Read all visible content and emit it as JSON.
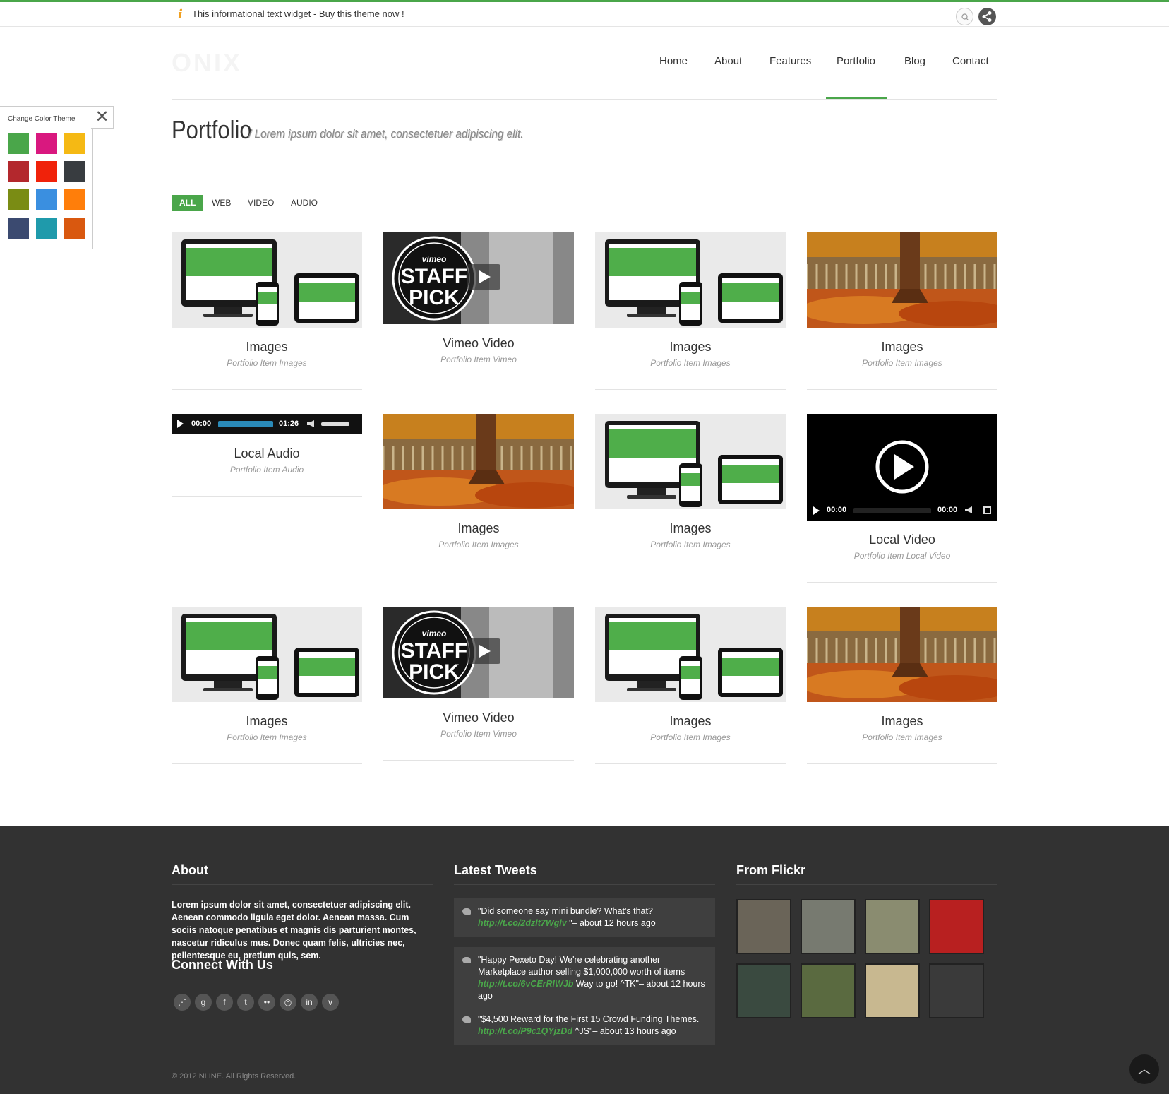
{
  "topbar": {
    "info_text": "This informational text widget - Buy this theme now !"
  },
  "logo": "ONIX",
  "nav": {
    "items": [
      "Home",
      "About",
      "Features",
      "Portfolio",
      "Blog",
      "Contact"
    ],
    "active": "Portfolio"
  },
  "page": {
    "title": "Portfolio",
    "subtitle": "/ Lorem ipsum dolor sit amet, consectetuer adipiscing elit."
  },
  "filters": [
    "ALL",
    "WEB",
    "VIDEO",
    "AUDIO"
  ],
  "color_panel": {
    "label": "Change Color Theme",
    "close": "✕",
    "swatches": [
      "#4aa64a",
      "#d9187f",
      "#f5b914",
      "#b3282d",
      "#f0220a",
      "#383c40",
      "#7a8c14",
      "#3a8fe0",
      "#ff7e0a",
      "#3b4a70",
      "#1f9aab",
      "#d9580f"
    ]
  },
  "portfolio": {
    "items": [
      {
        "title": "Images",
        "subtitle": "Portfolio Item Images",
        "thumb": "devices"
      },
      {
        "title": "Vimeo Video",
        "subtitle": "Portfolio Item Vimeo",
        "thumb": "vimeo"
      },
      {
        "title": "Images",
        "subtitle": "Portfolio Item Images",
        "thumb": "devices"
      },
      {
        "title": "Images",
        "subtitle": "Portfolio Item Images",
        "thumb": "autumn"
      },
      {
        "title": "Local Audio",
        "subtitle": "Portfolio Item Audio",
        "thumb": "audio"
      },
      {
        "title": "Images",
        "subtitle": "Portfolio Item Images",
        "thumb": "autumn"
      },
      {
        "title": "Images",
        "subtitle": "Portfolio Item Images",
        "thumb": "devices"
      },
      {
        "title": "Local Video",
        "subtitle": "Portfolio Item Local Video",
        "thumb": "video"
      },
      {
        "title": "Images",
        "subtitle": "Portfolio Item Images",
        "thumb": "devices"
      },
      {
        "title": "Vimeo Video",
        "subtitle": "Portfolio Item Vimeo",
        "thumb": "vimeo"
      },
      {
        "title": "Images",
        "subtitle": "Portfolio Item Images",
        "thumb": "devices"
      },
      {
        "title": "Images",
        "subtitle": "Portfolio Item Images",
        "thumb": "autumn"
      }
    ],
    "audio": {
      "current": "00:00",
      "duration": "01:26"
    },
    "video": {
      "current": "00:00",
      "duration": "00:00"
    },
    "vimeo_badge": {
      "brand": "vimeo",
      "line1": "STAFF",
      "line2": "PICK"
    }
  },
  "footer": {
    "about_heading": "About",
    "about_text": "Lorem ipsum dolor sit amet, consectetuer adipiscing elit. Aenean commodo ligula eget dolor. Aenean massa. Cum sociis natoque penatibus et magnis dis parturient montes, nascetur ridiculus mus. Donec quam felis, ultricies nec, pellentesque eu, pretium quis, sem.",
    "connect_heading": "Connect With Us",
    "social_icons": [
      "share-icon",
      "google-icon",
      "facebook-icon",
      "twitter-icon",
      "flickr-icon",
      "dribbble-icon",
      "linkedin-icon",
      "vimeo-icon"
    ],
    "social_glyphs": [
      "⋰",
      "g",
      "f",
      "t",
      "••",
      "◎",
      "in",
      "v"
    ],
    "tweets_heading": "Latest Tweets",
    "tweets": [
      {
        "text": "\"Did someone say mini bundle? What's that?",
        "link": "http://t.co/2dzlt7Wglv",
        "after": "\"– about 12 hours ago"
      },
      {
        "text": "\"Happy Pexeto Day! We're celebrating another Marketplace author selling $1,000,000 worth of items",
        "link": "http://t.co/6vCErRlWJb",
        "after": "Way to go! ^TK\"– about 12 hours ago"
      },
      {
        "text": "\"$4,500 Reward for the First 15 Crowd Funding Themes.",
        "link": "http://t.co/P9c1QYjzDd",
        "after": "^JS\"– about 13 hours ago"
      }
    ],
    "flickr_heading": "From Flickr",
    "flickr_colors": [
      "#6a6458",
      "#777a70",
      "#8a8c70",
      "#b82020",
      "#3a4a40",
      "#5a6a40",
      "#c8b890",
      "#3a3a3a"
    ],
    "copyright": "© 2012 NLINE. All Rights Reserved.",
    "totop": "︿"
  }
}
